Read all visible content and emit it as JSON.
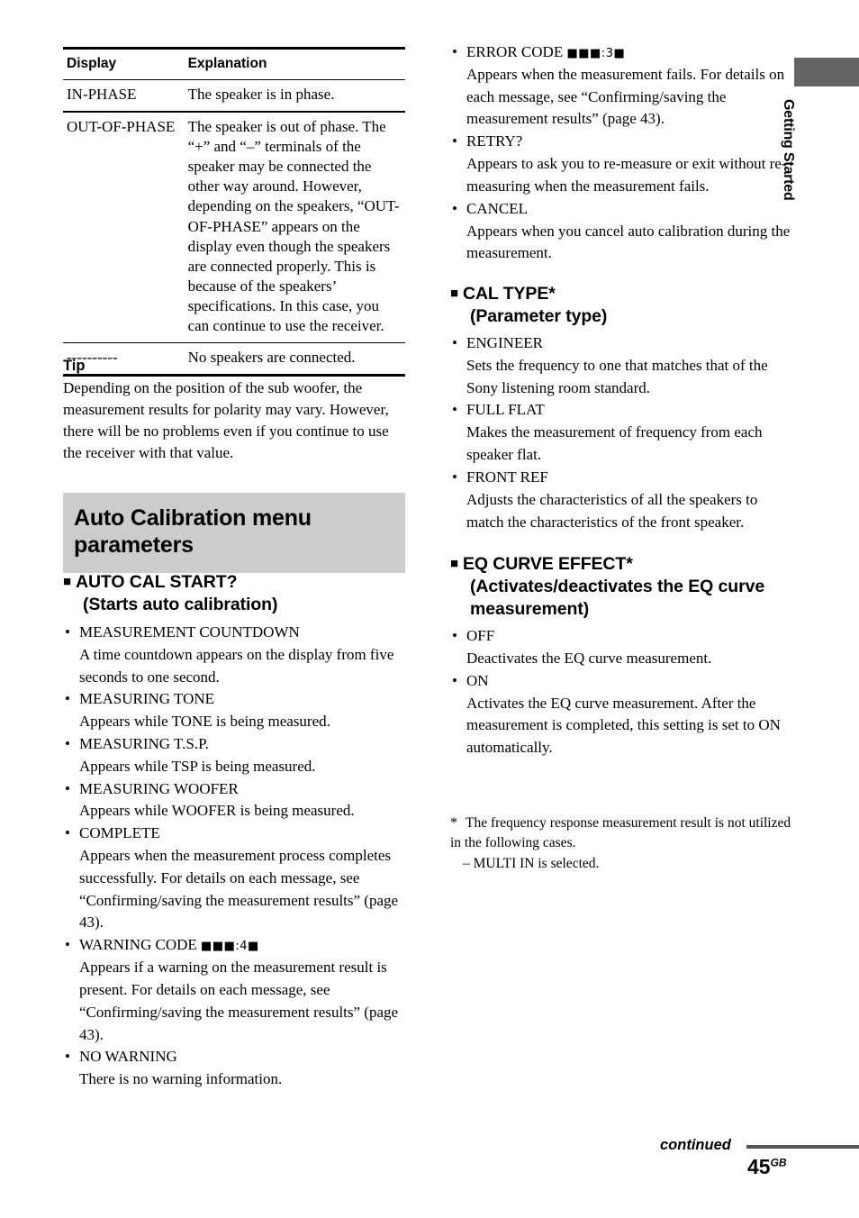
{
  "table": {
    "headers": [
      "Display",
      "Explanation"
    ],
    "rows": [
      {
        "display": "IN-PHASE",
        "explanation": "The speaker is in phase."
      },
      {
        "display": "OUT-OF-PHASE",
        "explanation": "The speaker is out of phase. The “+” and “–” terminals of the speaker may be connected the other way around. However, depending on the speakers, “OUT-OF-PHASE” appears on the display even though the speakers are connected properly. This is because of the speakers’ specifications. In this case, you can continue to use the receiver."
      },
      {
        "display": "----------",
        "explanation": "No speakers are connected."
      }
    ]
  },
  "tip": {
    "heading": "Tip",
    "body": "Depending on the position of the sub woofer, the measurement results for polarity may vary. However, there will be no problems even if you continue to use the receiver with that value."
  },
  "section_header": {
    "line1": "Auto Calibration menu",
    "line2": "parameters"
  },
  "sections": [
    {
      "id": "auto-cal-start",
      "title": "AUTO CAL START?",
      "subtitle": "(Starts auto calibration)",
      "items": [
        {
          "term": "MEASUREMENT COUNTDOWN",
          "desc": "A time countdown appears on the display from five seconds to one second."
        },
        {
          "term": "MEASURING TONE",
          "desc": "Appears while TONE is being measured."
        },
        {
          "term": "MEASURING T.S.P.",
          "desc": "Appears while TSP is being measured."
        },
        {
          "term": "MEASURING WOOFER",
          "desc": "Appears while WOOFER is being measured."
        },
        {
          "term": "COMPLETE",
          "desc": "Appears when the measurement process completes successfully. For details on each message, see “Confirming/saving the measurement results” (page 43)."
        },
        {
          "term": "WARNING CODE ",
          "term_code": "■■■:4■",
          "desc": "Appears if a warning on the measurement result is present. For details on each message, see “Confirming/saving the measurement results” (page 43)."
        },
        {
          "term": "NO WARNING",
          "desc": "There is no warning information."
        }
      ]
    },
    {
      "id": "error-codes",
      "items": [
        {
          "term": "ERROR CODE ",
          "term_code": "■■■:3■",
          "desc": "Appears when the measurement fails. For details on each message, see “Confirming/saving the measurement results” (page 43)."
        },
        {
          "term": "RETRY?",
          "desc": "Appears to ask you to re-measure or exit without re-measuring when the measurement fails."
        },
        {
          "term": "CANCEL",
          "desc": "Appears when you cancel auto calibration during the measurement."
        }
      ]
    },
    {
      "id": "cal-type",
      "title": "CAL TYPE*",
      "subtitle": "(Parameter type)",
      "items": [
        {
          "term": "ENGINEER",
          "desc": "Sets the frequency to one that matches that of the Sony listening room standard."
        },
        {
          "term": "FULL FLAT",
          "desc": "Makes the measurement of frequency from each speaker flat."
        },
        {
          "term": "FRONT REF",
          "desc": "Adjusts the characteristics of all the speakers to match the characteristics of the front speaker."
        }
      ]
    },
    {
      "id": "eq-curve-effect",
      "title": "EQ CURVE EFFECT*",
      "subtitle": "(Activates/deactivates the EQ curve measurement)",
      "items": [
        {
          "term": "OFF",
          "desc": "Deactivates the EQ curve measurement."
        },
        {
          "term": "ON",
          "desc": "Activates the EQ curve measurement. After the measurement is completed, this setting is set to ON automatically."
        }
      ]
    }
  ],
  "footnote": {
    "marker": "*",
    "body": "The frequency response measurement result is not utilized in the following cases.",
    "sub": "– MULTI IN is selected."
  },
  "side_tab": {
    "label": "Getting Started",
    "color": "#646464"
  },
  "footer": {
    "continued": "continued",
    "page_number": "45",
    "page_suffix": "GB"
  },
  "bullet_glyph": "•",
  "square_glyph": "■"
}
